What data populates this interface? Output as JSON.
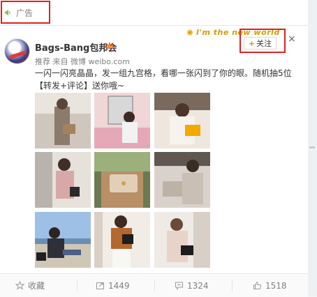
{
  "ad_bar": {
    "label": "广告"
  },
  "post": {
    "user_name": "Bags-Bang包邦会",
    "meta": "推荐 来自 微博 weibo.com",
    "text": "一闪一闪亮晶晶，发一组九宫格，看哪一张闪到了你的眼。随机抽5位【转发+评论】送你哦~",
    "watermark": "I'm the new world",
    "follow_label": "关注",
    "close_glyph": "×",
    "photos": [
      {
        "name": "photo-1",
        "tone": "#c9b8a4"
      },
      {
        "name": "photo-2",
        "tone": "#e6c7c9"
      },
      {
        "name": "photo-3",
        "tone": "#d9b79a"
      },
      {
        "name": "photo-4",
        "tone": "#d8c9c4"
      },
      {
        "name": "photo-5",
        "tone": "#b79b7f"
      },
      {
        "name": "photo-6",
        "tone": "#bcb4ae"
      },
      {
        "name": "photo-7",
        "tone": "#7f94b3"
      },
      {
        "name": "photo-8",
        "tone": "#c98a52"
      },
      {
        "name": "photo-9",
        "tone": "#d9cfc4"
      }
    ]
  },
  "actions": {
    "favorite": "收藏",
    "repost": "1449",
    "comment": "1324",
    "like": "1518"
  },
  "icons": {
    "ad": "megaphone-icon",
    "crown": "crown-icon",
    "favorite": "star-icon",
    "repost": "repost-icon",
    "comment": "comment-icon",
    "like": "thumbs-up-icon"
  },
  "colors": {
    "highlight": "#e02020",
    "accent": "#ff8200",
    "muted": "#808080"
  }
}
